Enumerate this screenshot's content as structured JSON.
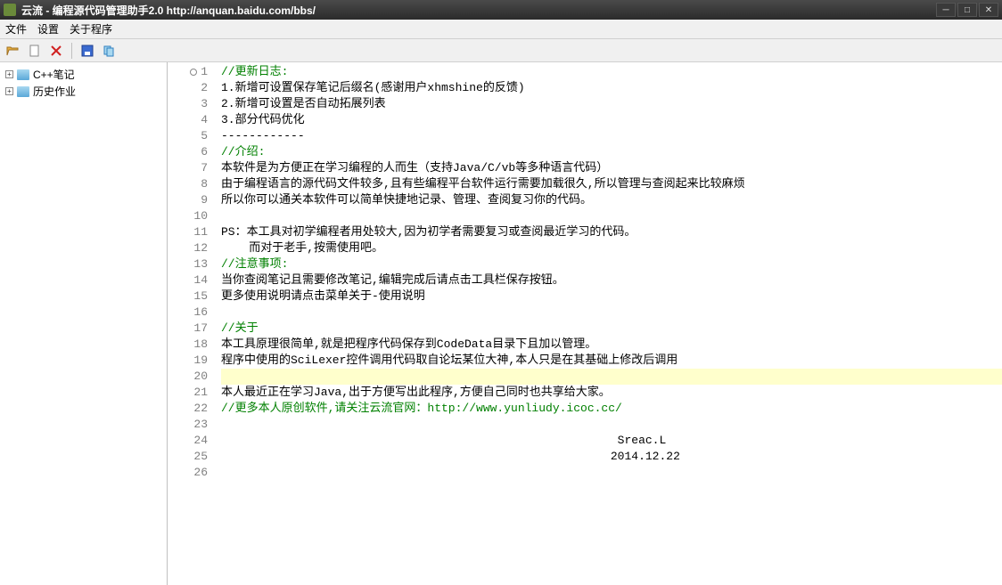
{
  "title": "云流 - 编程源代码管理助手2.0   http://anquan.baidu.com/bbs/",
  "menu": {
    "file": "文件",
    "settings": "设置",
    "about": "关于程序"
  },
  "tree": {
    "item1": "C++笔记",
    "item2": "历史作业"
  },
  "lines": [
    {
      "n": 1,
      "cls": "comment",
      "text": "//更新日志:",
      "marker": true
    },
    {
      "n": 2,
      "cls": "",
      "text": "1.新增可设置保存笔记后缀名(感谢用户xhmshine的反馈)"
    },
    {
      "n": 3,
      "cls": "",
      "text": "2.新增可设置是否自动拓展列表"
    },
    {
      "n": 4,
      "cls": "",
      "text": "3.部分代码优化"
    },
    {
      "n": 5,
      "cls": "",
      "text": "------------"
    },
    {
      "n": 6,
      "cls": "comment",
      "text": "//介绍:"
    },
    {
      "n": 7,
      "cls": "",
      "text": "本软件是为方便正在学习编程的人而生（支持Java/C/vb等多种语言代码）"
    },
    {
      "n": 8,
      "cls": "",
      "text": "由于编程语言的源代码文件较多,且有些编程平台软件运行需要加载很久,所以管理与查阅起来比较麻烦"
    },
    {
      "n": 9,
      "cls": "",
      "text": "所以你可以通关本软件可以简单快捷地记录、管理、查阅复习你的代码。"
    },
    {
      "n": 10,
      "cls": "",
      "text": ""
    },
    {
      "n": 11,
      "cls": "",
      "text": "PS：本工具对初学编程者用处较大,因为初学者需要复习或查阅最近学习的代码。"
    },
    {
      "n": 12,
      "cls": "",
      "text": "    而对于老手,按需使用吧。"
    },
    {
      "n": 13,
      "cls": "comment",
      "text": "//注意事项:"
    },
    {
      "n": 14,
      "cls": "",
      "text": "当你查阅笔记且需要修改笔记,编辑完成后请点击工具栏保存按钮。"
    },
    {
      "n": 15,
      "cls": "",
      "text": "更多使用说明请点击菜单关于-使用说明"
    },
    {
      "n": 16,
      "cls": "",
      "text": ""
    },
    {
      "n": 17,
      "cls": "comment",
      "text": "//关于"
    },
    {
      "n": 18,
      "cls": "",
      "text": "本工具原理很简单,就是把程序代码保存到CodeData目录下且加以管理。"
    },
    {
      "n": 19,
      "cls": "",
      "text": "程序中使用的SciLexer控件调用代码取自论坛某位大神,本人只是在其基础上修改后调用"
    },
    {
      "n": 20,
      "cls": "highlight",
      "text": ""
    },
    {
      "n": 21,
      "cls": "",
      "text": "本人最近正在学习Java,出于方便写出此程序,方便自己同时也共享给大家。"
    },
    {
      "n": 22,
      "cls": "comment",
      "text": "//更多本人原创软件,请关注云流官网：http://www.yunliudy.icoc.cc/"
    },
    {
      "n": 23,
      "cls": "",
      "text": ""
    },
    {
      "n": 24,
      "cls": "",
      "text": "                                                         Sreac.L"
    },
    {
      "n": 25,
      "cls": "",
      "text": "                                                        2014.12.22"
    },
    {
      "n": 26,
      "cls": "",
      "text": ""
    }
  ]
}
